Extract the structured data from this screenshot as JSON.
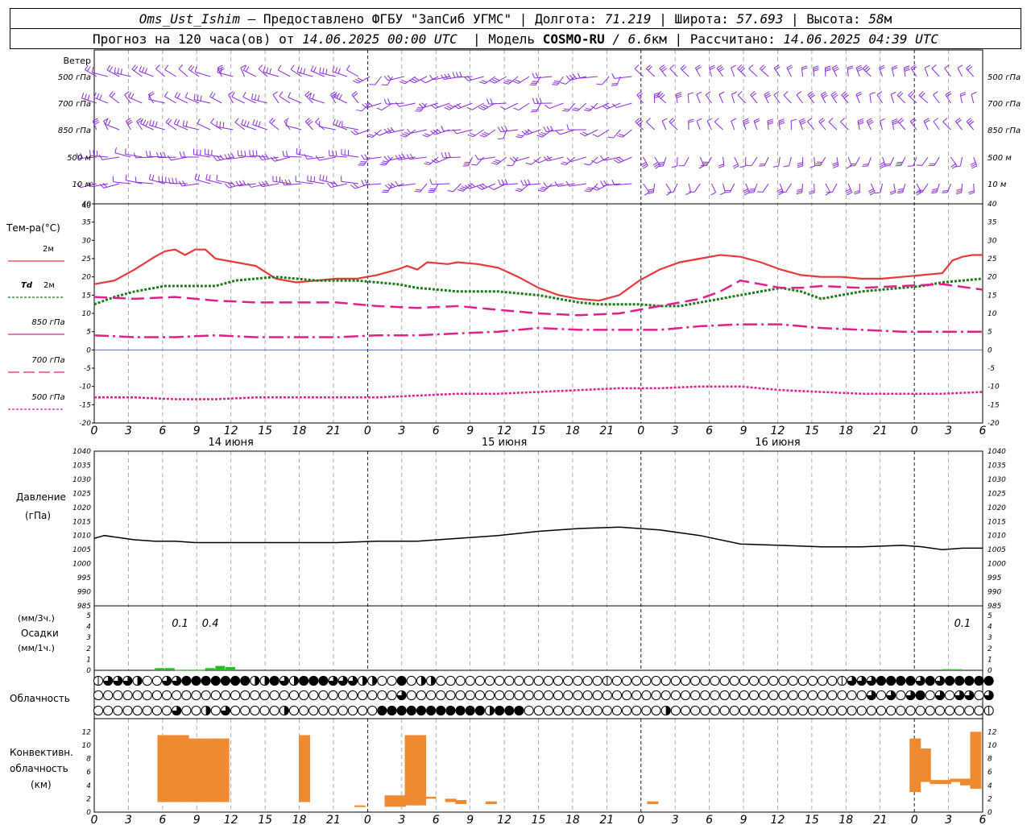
{
  "header": {
    "station": "Oms_Ust_Ishim",
    "provided_by": "– Предоставлено ФГБУ \"ЗапСиб УГМС\"",
    "lon_label": "Долгота:",
    "lon_value": "71.219",
    "lat_label": "Широта:",
    "lat_value": "57.693",
    "alt_label": "Высота:",
    "alt_value": "58",
    "alt_unit": "м",
    "forecast_prefix": "Прогноз на 120 часа(ов) от",
    "forecast_start": "14.06.2025 00:00 UTC",
    "model_label": "Модель",
    "model_name": "COSMO-RU",
    "model_res": "/ 6.6",
    "model_res_unit": "км",
    "calc_label": "Рассчитано:",
    "calc_time": "14.06.2025 04:39 UTC"
  },
  "hour_ticks": [
    "0",
    "3",
    "6",
    "9",
    "12",
    "15",
    "18",
    "21",
    "0",
    "3",
    "6",
    "9",
    "12",
    "15",
    "18",
    "21",
    "0",
    "3",
    "6",
    "9",
    "12",
    "15",
    "18",
    "21",
    "0",
    "3",
    "6"
  ],
  "day_labels": [
    "14 июня",
    "15 июня",
    "16 июня"
  ],
  "wind_panel": {
    "title": "Ветер",
    "levels": [
      "500 гПа",
      "700 гПа",
      "850 гПа",
      "500 м",
      "10 м"
    ],
    "right_levels": [
      "500 гПа",
      "700 гПа",
      "850 гПа",
      "500 м",
      "10 м"
    ],
    "color": "#8a2be2"
  },
  "temp_panel": {
    "ylabel": "Тем-ра(°С)",
    "yticks": [
      "40",
      "35",
      "30",
      "25",
      "20",
      "15",
      "10",
      "5",
      "0",
      "-5",
      "-10",
      "-15",
      "-20"
    ],
    "legend": [
      {
        "label": "2м",
        "color": "#e8393a",
        "style": "solid"
      },
      {
        "label_italic": "Td",
        "label": "2м",
        "color": "#1a7a1a",
        "style": "dotted"
      },
      {
        "label": "850 гПа",
        "color": "#e0208a",
        "style": "solid"
      },
      {
        "label": "700 гПа",
        "color": "#e0208a",
        "style": "dashed"
      },
      {
        "label": "500 гПа",
        "color": "#e0208a",
        "style": "dotted"
      }
    ]
  },
  "pressure_panel": {
    "ylabel1": "Давление",
    "ylabel2": "(гПа)",
    "yticks": [
      "1040",
      "1035",
      "1030",
      "1025",
      "1020",
      "1015",
      "1010",
      "1005",
      "1000",
      "995",
      "990",
      "985"
    ]
  },
  "precip_panel": {
    "ylabel1": "(мм/3ч.)",
    "ylabel2": "Осадки",
    "ylabel3": "(мм/1ч.)",
    "yticks": [
      "5",
      "4",
      "3",
      "2",
      "1",
      "0"
    ],
    "annotations": [
      {
        "x_hours": 8.5,
        "text": "0.1"
      },
      {
        "x_hours": 11.5,
        "text": "0.4"
      },
      {
        "x_hours": 86,
        "text": "0.1"
      }
    ],
    "color": "#22c022"
  },
  "cloud_panel": {
    "label": "Облачность"
  },
  "conv_panel": {
    "ylabel1": "Конвективн.",
    "ylabel2": "облачность",
    "ylabel3": "(км)",
    "yticks": [
      "12",
      "10",
      "8",
      "6",
      "4",
      "2",
      "0"
    ],
    "color": "#f08a30"
  },
  "chart_data": [
    {
      "type": "line",
      "title": "Тем-ра(°С)",
      "x_unit": "hours since 14.06.2025 00:00 UTC",
      "ylim": [
        -20,
        40
      ],
      "series": [
        {
          "name": "2м",
          "color": "#e8393a",
          "x": [
            0,
            2,
            4,
            6,
            7,
            8,
            9,
            10,
            11,
            12,
            14,
            16,
            18,
            20,
            22,
            24,
            26,
            28,
            30,
            31,
            32,
            33,
            35,
            36,
            38,
            40,
            42,
            44,
            46,
            48,
            50,
            52,
            54,
            56,
            58,
            60,
            62,
            64,
            66,
            68,
            70,
            72,
            74,
            76,
            78,
            80,
            82,
            84,
            85,
            86,
            87,
            88
          ],
          "y": [
            18,
            19,
            22,
            25.5,
            27,
            27.5,
            26,
            27.5,
            27.5,
            25,
            24,
            23,
            19.5,
            18.5,
            19,
            19.5,
            19.5,
            20.5,
            22,
            23,
            22,
            24,
            23.5,
            24,
            23.5,
            22.5,
            20,
            17,
            15,
            14,
            13.5,
            15,
            19,
            22,
            24,
            25,
            26,
            25.5,
            24,
            22,
            20.5,
            20,
            20,
            19.5,
            19.5,
            20,
            20.5,
            21,
            24.5,
            25.5,
            26,
            26
          ]
        },
        {
          "name": "Td 2м",
          "color": "#1a7a1a",
          "x": [
            0,
            2,
            4,
            6,
            7,
            8,
            10,
            12,
            14,
            16,
            18,
            20,
            22,
            24,
            26,
            28,
            30,
            32,
            34,
            36,
            38,
            40,
            42,
            44,
            46,
            48,
            50,
            52,
            54,
            56,
            58,
            60,
            62,
            64,
            66,
            68,
            70,
            72,
            74,
            76,
            78,
            80,
            82,
            84,
            86,
            88
          ],
          "y": [
            12.5,
            14.5,
            16,
            17,
            17.5,
            17.5,
            17.5,
            17.5,
            19,
            19.5,
            20,
            19.5,
            19,
            19,
            19,
            18.5,
            18,
            17,
            16.5,
            16,
            16,
            16,
            15.5,
            15,
            14,
            13,
            12.5,
            12.5,
            12.5,
            12,
            12,
            13,
            14,
            15,
            16,
            17,
            16,
            14,
            15,
            16,
            16.5,
            17,
            17.5,
            18.5,
            19,
            19.5
          ]
        },
        {
          "name": "850 гПа",
          "color": "#e0208a",
          "x": [
            0,
            4,
            8,
            12,
            16,
            20,
            24,
            28,
            32,
            36,
            40,
            44,
            48,
            52,
            56,
            60,
            62,
            64,
            66,
            68,
            70,
            72,
            76,
            80,
            84,
            88
          ],
          "y": [
            14.5,
            14,
            14.5,
            13.5,
            13,
            13,
            13,
            12,
            11.5,
            12,
            11,
            10,
            9.5,
            10,
            12,
            14,
            16,
            19,
            18,
            17,
            17,
            17.5,
            17,
            17.5,
            18,
            16.5
          ]
        },
        {
          "name": "700 гПа",
          "color": "#e0208a",
          "x": [
            0,
            4,
            8,
            12,
            16,
            20,
            24,
            28,
            32,
            36,
            40,
            44,
            48,
            52,
            56,
            60,
            64,
            68,
            72,
            76,
            80,
            84,
            88
          ],
          "y": [
            4,
            3.5,
            3.5,
            4,
            3.5,
            3.5,
            3.5,
            4,
            4,
            4.5,
            5,
            6,
            5.5,
            5.5,
            5.5,
            6.5,
            7,
            7,
            6,
            5.5,
            5,
            5,
            5
          ]
        },
        {
          "name": "500 гПа",
          "color": "#e0208a",
          "x": [
            0,
            4,
            8,
            12,
            16,
            20,
            24,
            28,
            32,
            36,
            40,
            44,
            48,
            52,
            56,
            60,
            64,
            68,
            72,
            76,
            80,
            84,
            88
          ],
          "y": [
            -13,
            -13,
            -13.5,
            -13.5,
            -13,
            -13,
            -13,
            -13,
            -12.5,
            -12,
            -12,
            -11.5,
            -11,
            -10.5,
            -10.5,
            -10,
            -10,
            -11,
            -11.5,
            -12,
            -12,
            -12,
            -11.5
          ]
        }
      ]
    },
    {
      "type": "line",
      "title": "Давление",
      "ylabel": "(гПа)",
      "x_unit": "hours since 14.06.2025 00:00 UTC",
      "ylim": [
        985,
        1040
      ],
      "series": [
        {
          "name": "Давление",
          "color": "#000000",
          "x": [
            0,
            1,
            2,
            4,
            6,
            8,
            10,
            12,
            16,
            20,
            24,
            28,
            32,
            36,
            40,
            44,
            48,
            52,
            56,
            60,
            64,
            68,
            72,
            76,
            80,
            82,
            84,
            86,
            88
          ],
          "y": [
            1009,
            1010,
            1009.5,
            1008.5,
            1008,
            1008,
            1007.5,
            1007.5,
            1007.5,
            1007.5,
            1007.5,
            1008,
            1008,
            1009,
            1010,
            1011.5,
            1012.5,
            1013,
            1012,
            1010,
            1007,
            1006.5,
            1006,
            1006,
            1006.5,
            1006,
            1005,
            1005.5,
            1005.5
          ]
        }
      ]
    },
    {
      "type": "bar",
      "title": "Осадки",
      "ylabel": "(мм/3ч.) / (мм/1ч.)",
      "ylim": [
        0,
        5
      ],
      "x_hours": [
        6,
        7,
        8,
        9,
        10,
        11,
        12,
        13,
        84,
        85
      ],
      "values": [
        0.2,
        0.2,
        0.05,
        0.05,
        0.05,
        0.2,
        0.4,
        0.3,
        0.1,
        0.1
      ]
    },
    {
      "type": "bar",
      "title": "Конвективн. облачность",
      "ylabel": "(км)",
      "ylim": [
        0,
        13
      ],
      "bars": [
        {
          "x_hours": 6.5,
          "bottom": 1.5,
          "top": 11.5
        },
        {
          "x_hours": 7.5,
          "bottom": 1.5,
          "top": 11.5
        },
        {
          "x_hours": 8.5,
          "bottom": 1.5,
          "top": 11.5
        },
        {
          "x_hours": 9.5,
          "bottom": 1.5,
          "top": 11
        },
        {
          "x_hours": 10.5,
          "bottom": 1.5,
          "top": 11
        },
        {
          "x_hours": 11.5,
          "bottom": 1.5,
          "top": 11
        },
        {
          "x_hours": 12.5,
          "bottom": 1.5,
          "top": 11
        },
        {
          "x_hours": 20.5,
          "bottom": 1.5,
          "top": 11.5
        },
        {
          "x_hours": 26,
          "bottom": 0.8,
          "top": 1.0
        },
        {
          "x_hours": 29,
          "bottom": 0.8,
          "top": 2.5
        },
        {
          "x_hours": 30,
          "bottom": 0.8,
          "top": 2.5
        },
        {
          "x_hours": 31,
          "bottom": 1.0,
          "top": 11.5
        },
        {
          "x_hours": 32,
          "bottom": 1.0,
          "top": 11.5
        },
        {
          "x_hours": 33,
          "bottom": 2.0,
          "top": 2.3
        },
        {
          "x_hours": 35,
          "bottom": 1.5,
          "top": 2.0
        },
        {
          "x_hours": 36,
          "bottom": 1.2,
          "top": 1.8
        },
        {
          "x_hours": 39,
          "bottom": 1.2,
          "top": 1.6
        },
        {
          "x_hours": 55,
          "bottom": 1.2,
          "top": 1.6
        },
        {
          "x_hours": 81,
          "bottom": 3.0,
          "top": 11
        },
        {
          "x_hours": 82,
          "bottom": 4.5,
          "top": 9.5
        },
        {
          "x_hours": 83,
          "bottom": 4.2,
          "top": 4.8
        },
        {
          "x_hours": 84,
          "bottom": 4.2,
          "top": 4.8
        },
        {
          "x_hours": 85,
          "bottom": 4.5,
          "top": 5.0
        },
        {
          "x_hours": 86,
          "bottom": 4.0,
          "top": 5.0
        },
        {
          "x_hours": 87,
          "bottom": 3.5,
          "top": 12
        }
      ]
    }
  ],
  "cloud_rows": [
    [
      1,
      3,
      3,
      3,
      2,
      0,
      0,
      3,
      3,
      4,
      4,
      4,
      4,
      4,
      4,
      4,
      2,
      2,
      4,
      3,
      2,
      4,
      4,
      4,
      3,
      3,
      3,
      2,
      2,
      0,
      0,
      4,
      0,
      2,
      2,
      0,
      0,
      0,
      0,
      0,
      0,
      0,
      0,
      0,
      0,
      0,
      0,
      0,
      0,
      0,
      0,
      0,
      1,
      0,
      0,
      0,
      0,
      0,
      0,
      0,
      0,
      0,
      0,
      0,
      0,
      0,
      0,
      0,
      0,
      0,
      0,
      0,
      0,
      0,
      0,
      0,
      1,
      3,
      3,
      3,
      4,
      4,
      4,
      4,
      3,
      4,
      3,
      4,
      4,
      4,
      4,
      4
    ],
    [
      0,
      0,
      0,
      0,
      0,
      0,
      0,
      0,
      0,
      0,
      0,
      0,
      0,
      0,
      0,
      0,
      0,
      0,
      0,
      0,
      0,
      0,
      0,
      0,
      0,
      0,
      0,
      0,
      0,
      0,
      0,
      3,
      0,
      0,
      0,
      0,
      0,
      0,
      0,
      0,
      0,
      0,
      0,
      0,
      0,
      0,
      0,
      0,
      0,
      0,
      0,
      0,
      0,
      0,
      0,
      0,
      0,
      0,
      0,
      0,
      0,
      0,
      0,
      0,
      0,
      0,
      0,
      0,
      0,
      0,
      0,
      0,
      0,
      0,
      0,
      0,
      0,
      0,
      0,
      3,
      0,
      3,
      0,
      3,
      4,
      0,
      3,
      0,
      3,
      3,
      0,
      3
    ],
    [
      0,
      0,
      0,
      0,
      0,
      0,
      0,
      0,
      3,
      0,
      0,
      2,
      0,
      3,
      0,
      0,
      0,
      0,
      0,
      2,
      0,
      0,
      0,
      0,
      0,
      0,
      0,
      0,
      0,
      4,
      4,
      4,
      4,
      4,
      4,
      4,
      4,
      4,
      4,
      4,
      2,
      4,
      4,
      4,
      0,
      0,
      0,
      0,
      0,
      0,
      0,
      0,
      0,
      0,
      0,
      0,
      0,
      0,
      2,
      0,
      0,
      0,
      0,
      0,
      0,
      0,
      0,
      0,
      0,
      0,
      0,
      0,
      0,
      0,
      0,
      0,
      0,
      0,
      0,
      0,
      0,
      0,
      0,
      0,
      0,
      0,
      0,
      0,
      0,
      0,
      0,
      1
    ]
  ]
}
